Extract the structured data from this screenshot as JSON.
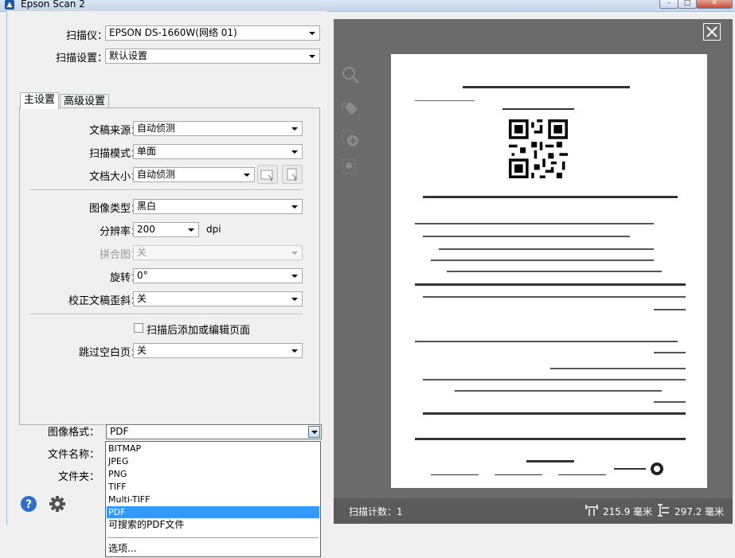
{
  "window": {
    "title": "Epson Scan 2"
  },
  "scanner": {
    "label": "扫描仪：",
    "value": "EPSON DS-1660W(网络 01)"
  },
  "scan_settings": {
    "label": "扫描设置：",
    "value": "默认设置"
  },
  "tabs": [
    {
      "label": "主设置"
    },
    {
      "label": "高级设置"
    }
  ],
  "main": {
    "document_source": {
      "label": "文稿来源：",
      "value": "自动侦测"
    },
    "scan_mode": {
      "label": "扫描模式：",
      "value": "单面"
    },
    "document_size": {
      "label": "文档大小：",
      "value": "自动侦测"
    },
    "image_type": {
      "label": "图像类型：",
      "value": "黑白"
    },
    "resolution": {
      "label": "分辨率：",
      "value": "200",
      "unit": "dpi"
    },
    "stitch": {
      "label": "拼合图：",
      "value": "关"
    },
    "rotate": {
      "label": "旋转：",
      "value": "0°"
    },
    "deskew": {
      "label": "校正文稿歪斜：",
      "value": "关"
    },
    "add_edit_pages": {
      "label": "扫描后添加或编辑页面"
    },
    "skip_blank": {
      "label": "跳过空白页：",
      "value": "关"
    }
  },
  "image_format": {
    "label": "图像格式：",
    "value": "PDF"
  },
  "file_name": {
    "label": "文件名称："
  },
  "folder": {
    "label": "文件夹："
  },
  "format_options": [
    "BITMAP",
    "JPEG",
    "PNG",
    "TIFF",
    "Multi-TIFF",
    "PDF",
    "可搜索的PDF文件"
  ],
  "format_selected": "PDF",
  "format_more": "选项...",
  "status": {
    "scan_count": "扫描计数：1",
    "width": "215.9 毫米",
    "height": "297.2 毫米"
  },
  "colors": {
    "accent": "#3399ff",
    "preview_bg": "#6b6b6b",
    "help": "#2e6fc7"
  },
  "icons": [
    "zoom-icon",
    "eraser-icon",
    "add-page-icon",
    "page-icon",
    "help-icon",
    "gear-icon",
    "close-icon",
    "width-icon",
    "height-icon"
  ]
}
